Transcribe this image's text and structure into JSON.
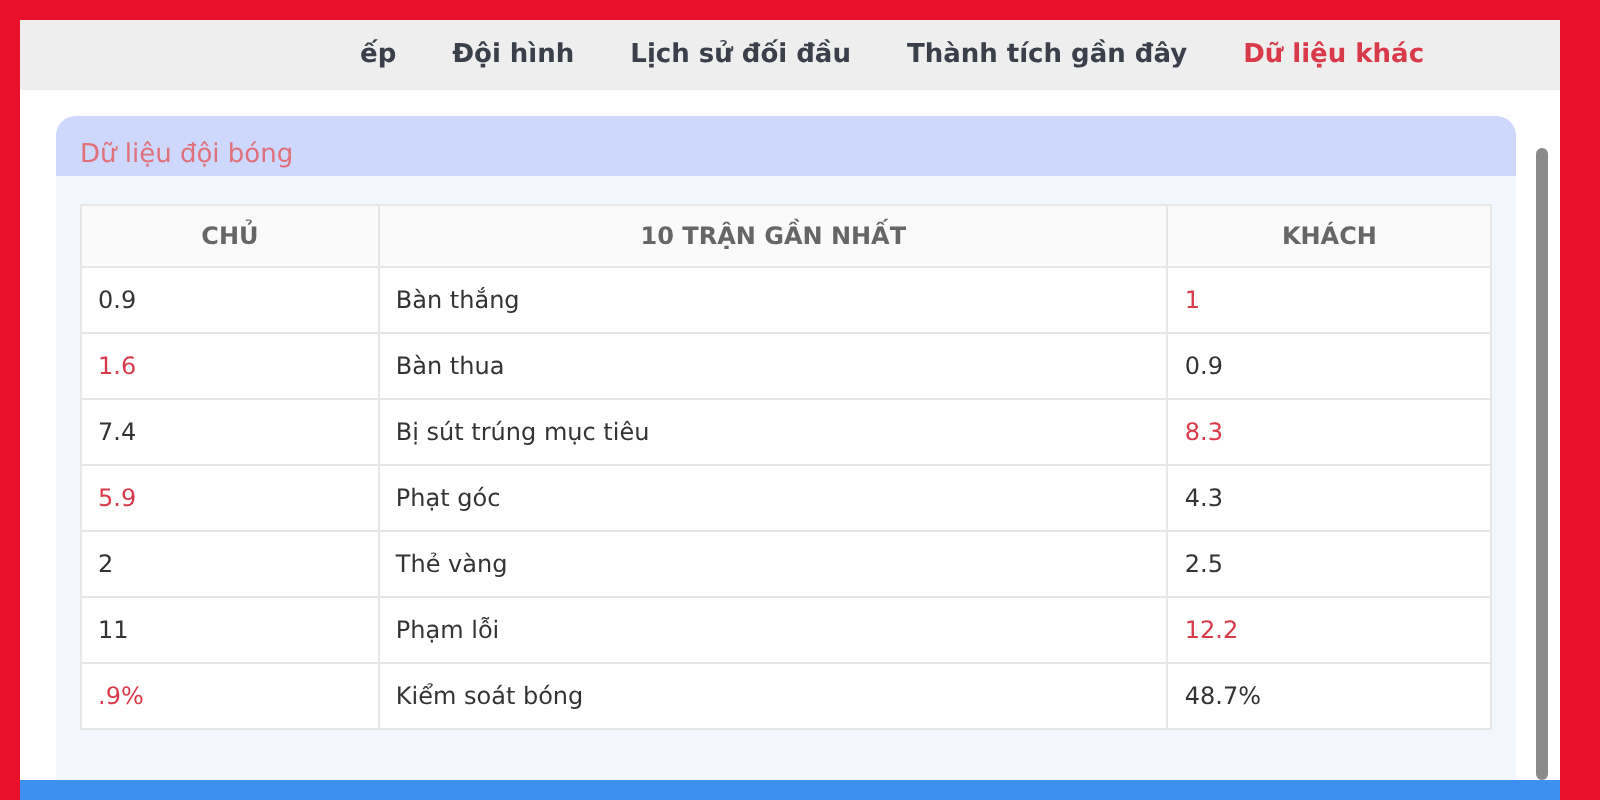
{
  "tabs": [
    {
      "label": "ếp",
      "selected": false
    },
    {
      "label": "Đội hình",
      "selected": false
    },
    {
      "label": "Lịch sử đối đầu",
      "selected": false
    },
    {
      "label": "Thành tích gần đây",
      "selected": false
    },
    {
      "label": "Dữ liệu khác",
      "selected": true
    }
  ],
  "panel": {
    "title": "Dữ liệu đội bóng",
    "table": {
      "columns": [
        "CHỦ",
        "10 TRẬN GẦN NHẤT",
        "KHÁCH"
      ],
      "rows": [
        {
          "home": "0.9",
          "home_highlight": false,
          "stat": "Bàn thắng",
          "away": "1",
          "away_highlight": true
        },
        {
          "home": "1.6",
          "home_highlight": true,
          "stat": "Bàn thua",
          "away": "0.9",
          "away_highlight": false
        },
        {
          "home": "7.4",
          "home_highlight": false,
          "stat": "Bị sút trúng mục tiêu",
          "away": "8.3",
          "away_highlight": true
        },
        {
          "home": "5.9",
          "home_highlight": true,
          "stat": "Phạt góc",
          "away": "4.3",
          "away_highlight": false
        },
        {
          "home": "2",
          "home_highlight": false,
          "stat": "Thẻ vàng",
          "away": "2.5",
          "away_highlight": false
        },
        {
          "home": "11",
          "home_highlight": false,
          "stat": "Phạm lỗi",
          "away": "12.2",
          "away_highlight": true
        },
        {
          "home": ".9%",
          "home_highlight": true,
          "stat": "Kiểm soát bóng",
          "away": "48.7%",
          "away_highlight": false
        }
      ]
    }
  }
}
